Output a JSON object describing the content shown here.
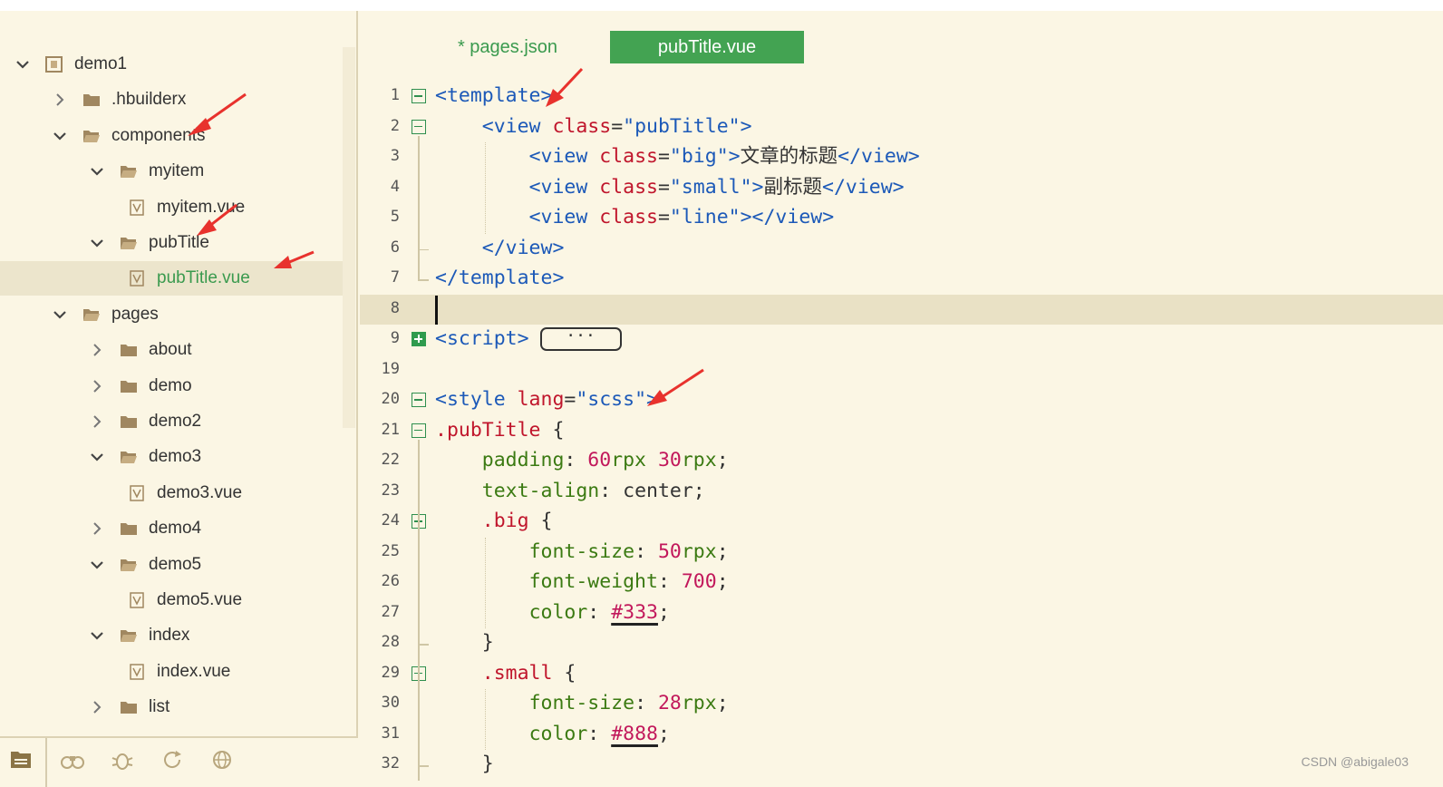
{
  "explorer": {
    "items": [
      {
        "label": "demo1",
        "depth": 0,
        "kind": "project",
        "expanded": true
      },
      {
        "label": ".hbuilderx",
        "depth": 1,
        "kind": "folder",
        "expanded": false
      },
      {
        "label": "components",
        "depth": 1,
        "kind": "folder-open",
        "expanded": true
      },
      {
        "label": "myitem",
        "depth": 2,
        "kind": "folder-open",
        "expanded": true
      },
      {
        "label": "myitem.vue",
        "depth": 3,
        "kind": "vue-file"
      },
      {
        "label": "pubTitle",
        "depth": 2,
        "kind": "folder-open",
        "expanded": true
      },
      {
        "label": "pubTitle.vue",
        "depth": 3,
        "kind": "vue-file",
        "selected": true
      },
      {
        "label": "pages",
        "depth": 1,
        "kind": "folder-open",
        "expanded": true
      },
      {
        "label": "about",
        "depth": 2,
        "kind": "folder",
        "expanded": false
      },
      {
        "label": "demo",
        "depth": 2,
        "kind": "folder",
        "expanded": false
      },
      {
        "label": "demo2",
        "depth": 2,
        "kind": "folder",
        "expanded": false
      },
      {
        "label": "demo3",
        "depth": 2,
        "kind": "folder-open",
        "expanded": true
      },
      {
        "label": "demo3.vue",
        "depth": 3,
        "kind": "vue-file"
      },
      {
        "label": "demo4",
        "depth": 2,
        "kind": "folder",
        "expanded": false
      },
      {
        "label": "demo5",
        "depth": 2,
        "kind": "folder-open",
        "expanded": true
      },
      {
        "label": "demo5.vue",
        "depth": 3,
        "kind": "vue-file"
      },
      {
        "label": "index",
        "depth": 2,
        "kind": "folder-open",
        "expanded": true
      },
      {
        "label": "index.vue",
        "depth": 3,
        "kind": "vue-file"
      },
      {
        "label": "list",
        "depth": 2,
        "kind": "folder",
        "expanded": false
      }
    ]
  },
  "bottom_tools": [
    "explorer-icon",
    "binoculars-icon",
    "bug-icon",
    "refresh-icon",
    "globe-icon"
  ],
  "tabs": [
    {
      "label": "* pages.json",
      "active": false
    },
    {
      "label": "pubTitle.vue",
      "active": true
    }
  ],
  "editor": {
    "current_line": "8",
    "collapsed_marker": "···",
    "lines": [
      {
        "num": "1",
        "fold": "minus",
        "tokens": [
          [
            "t",
            "<template>"
          ]
        ]
      },
      {
        "num": "2",
        "fold": "minus",
        "tokens": [
          [
            "p",
            "    "
          ],
          [
            "t",
            "<view "
          ],
          [
            "a",
            "class"
          ],
          [
            "p",
            "="
          ],
          [
            "s",
            "\"pubTitle\""
          ],
          [
            "t",
            ">"
          ]
        ]
      },
      {
        "num": "3",
        "tokens": [
          [
            "p",
            "        "
          ],
          [
            "t",
            "<view "
          ],
          [
            "a",
            "class"
          ],
          [
            "p",
            "="
          ],
          [
            "s",
            "\"big\""
          ],
          [
            "t",
            ">"
          ],
          [
            "p",
            "文章的标题"
          ],
          [
            "t",
            "</view>"
          ]
        ]
      },
      {
        "num": "4",
        "tokens": [
          [
            "p",
            "        "
          ],
          [
            "t",
            "<view "
          ],
          [
            "a",
            "class"
          ],
          [
            "p",
            "="
          ],
          [
            "s",
            "\"small\""
          ],
          [
            "t",
            ">"
          ],
          [
            "p",
            "副标题"
          ],
          [
            "t",
            "</view>"
          ]
        ]
      },
      {
        "num": "5",
        "tokens": [
          [
            "p",
            "        "
          ],
          [
            "t",
            "<view "
          ],
          [
            "a",
            "class"
          ],
          [
            "p",
            "="
          ],
          [
            "s",
            "\"line\""
          ],
          [
            "t",
            "></view>"
          ]
        ]
      },
      {
        "num": "6",
        "tokens": [
          [
            "p",
            "    "
          ],
          [
            "t",
            "</view>"
          ]
        ]
      },
      {
        "num": "7",
        "tokens": [
          [
            "t",
            "</template>"
          ]
        ]
      },
      {
        "num": "8",
        "tokens": []
      },
      {
        "num": "9",
        "fold": "plus",
        "tokens": [
          [
            "t",
            "<script>"
          ]
        ],
        "collapsed": true
      },
      {
        "num": "19",
        "tokens": []
      },
      {
        "num": "20",
        "fold": "minus",
        "tokens": [
          [
            "t",
            "<style "
          ],
          [
            "a",
            "lang"
          ],
          [
            "p",
            "="
          ],
          [
            "s",
            "\"scss\""
          ],
          [
            "t",
            ">"
          ]
        ]
      },
      {
        "num": "21",
        "fold": "minus",
        "tokens": [
          [
            "sel",
            ".pubTitle"
          ],
          [
            "p",
            " {"
          ]
        ]
      },
      {
        "num": "22",
        "tokens": [
          [
            "p",
            "    "
          ],
          [
            "prop",
            "padding"
          ],
          [
            "p",
            ": "
          ],
          [
            "n",
            "60"
          ],
          [
            "u",
            "rpx"
          ],
          [
            "p",
            " "
          ],
          [
            "n",
            "30"
          ],
          [
            "u",
            "rpx"
          ],
          [
            "p",
            ";"
          ]
        ]
      },
      {
        "num": "23",
        "tokens": [
          [
            "p",
            "    "
          ],
          [
            "prop",
            "text-align"
          ],
          [
            "p",
            ": center;"
          ]
        ]
      },
      {
        "num": "24",
        "fold": "minus",
        "tokens": [
          [
            "p",
            "    "
          ],
          [
            "sel",
            ".big"
          ],
          [
            "p",
            " {"
          ]
        ]
      },
      {
        "num": "25",
        "tokens": [
          [
            "p",
            "        "
          ],
          [
            "prop",
            "font-size"
          ],
          [
            "p",
            ": "
          ],
          [
            "n",
            "50"
          ],
          [
            "u",
            "rpx"
          ],
          [
            "p",
            ";"
          ]
        ]
      },
      {
        "num": "26",
        "tokens": [
          [
            "p",
            "        "
          ],
          [
            "prop",
            "font-weight"
          ],
          [
            "p",
            ": "
          ],
          [
            "n",
            "700"
          ],
          [
            "p",
            ";"
          ]
        ]
      },
      {
        "num": "27",
        "tokens": [
          [
            "p",
            "        "
          ],
          [
            "prop",
            "color"
          ],
          [
            "p",
            ": "
          ],
          [
            "n ul",
            "#333"
          ],
          [
            "p",
            ";"
          ]
        ]
      },
      {
        "num": "28",
        "tokens": [
          [
            "p",
            "    }"
          ]
        ]
      },
      {
        "num": "29",
        "fold": "minus",
        "tokens": [
          [
            "p",
            "    "
          ],
          [
            "sel",
            ".small"
          ],
          [
            "p",
            " {"
          ]
        ]
      },
      {
        "num": "30",
        "tokens": [
          [
            "p",
            "        "
          ],
          [
            "prop",
            "font-size"
          ],
          [
            "p",
            ": "
          ],
          [
            "n",
            "28"
          ],
          [
            "u",
            "rpx"
          ],
          [
            "p",
            ";"
          ]
        ]
      },
      {
        "num": "31",
        "tokens": [
          [
            "p",
            "        "
          ],
          [
            "prop",
            "color"
          ],
          [
            "p",
            ": "
          ],
          [
            "n ul",
            "#888"
          ],
          [
            "p",
            ";"
          ]
        ]
      },
      {
        "num": "32",
        "tokens": [
          [
            "p",
            "    }"
          ]
        ]
      }
    ]
  },
  "watermark": "CSDN @abigale03",
  "colors": {
    "accent": "#43a352",
    "background": "#fbf6e4",
    "annotation_arrow": "#e8322d"
  }
}
